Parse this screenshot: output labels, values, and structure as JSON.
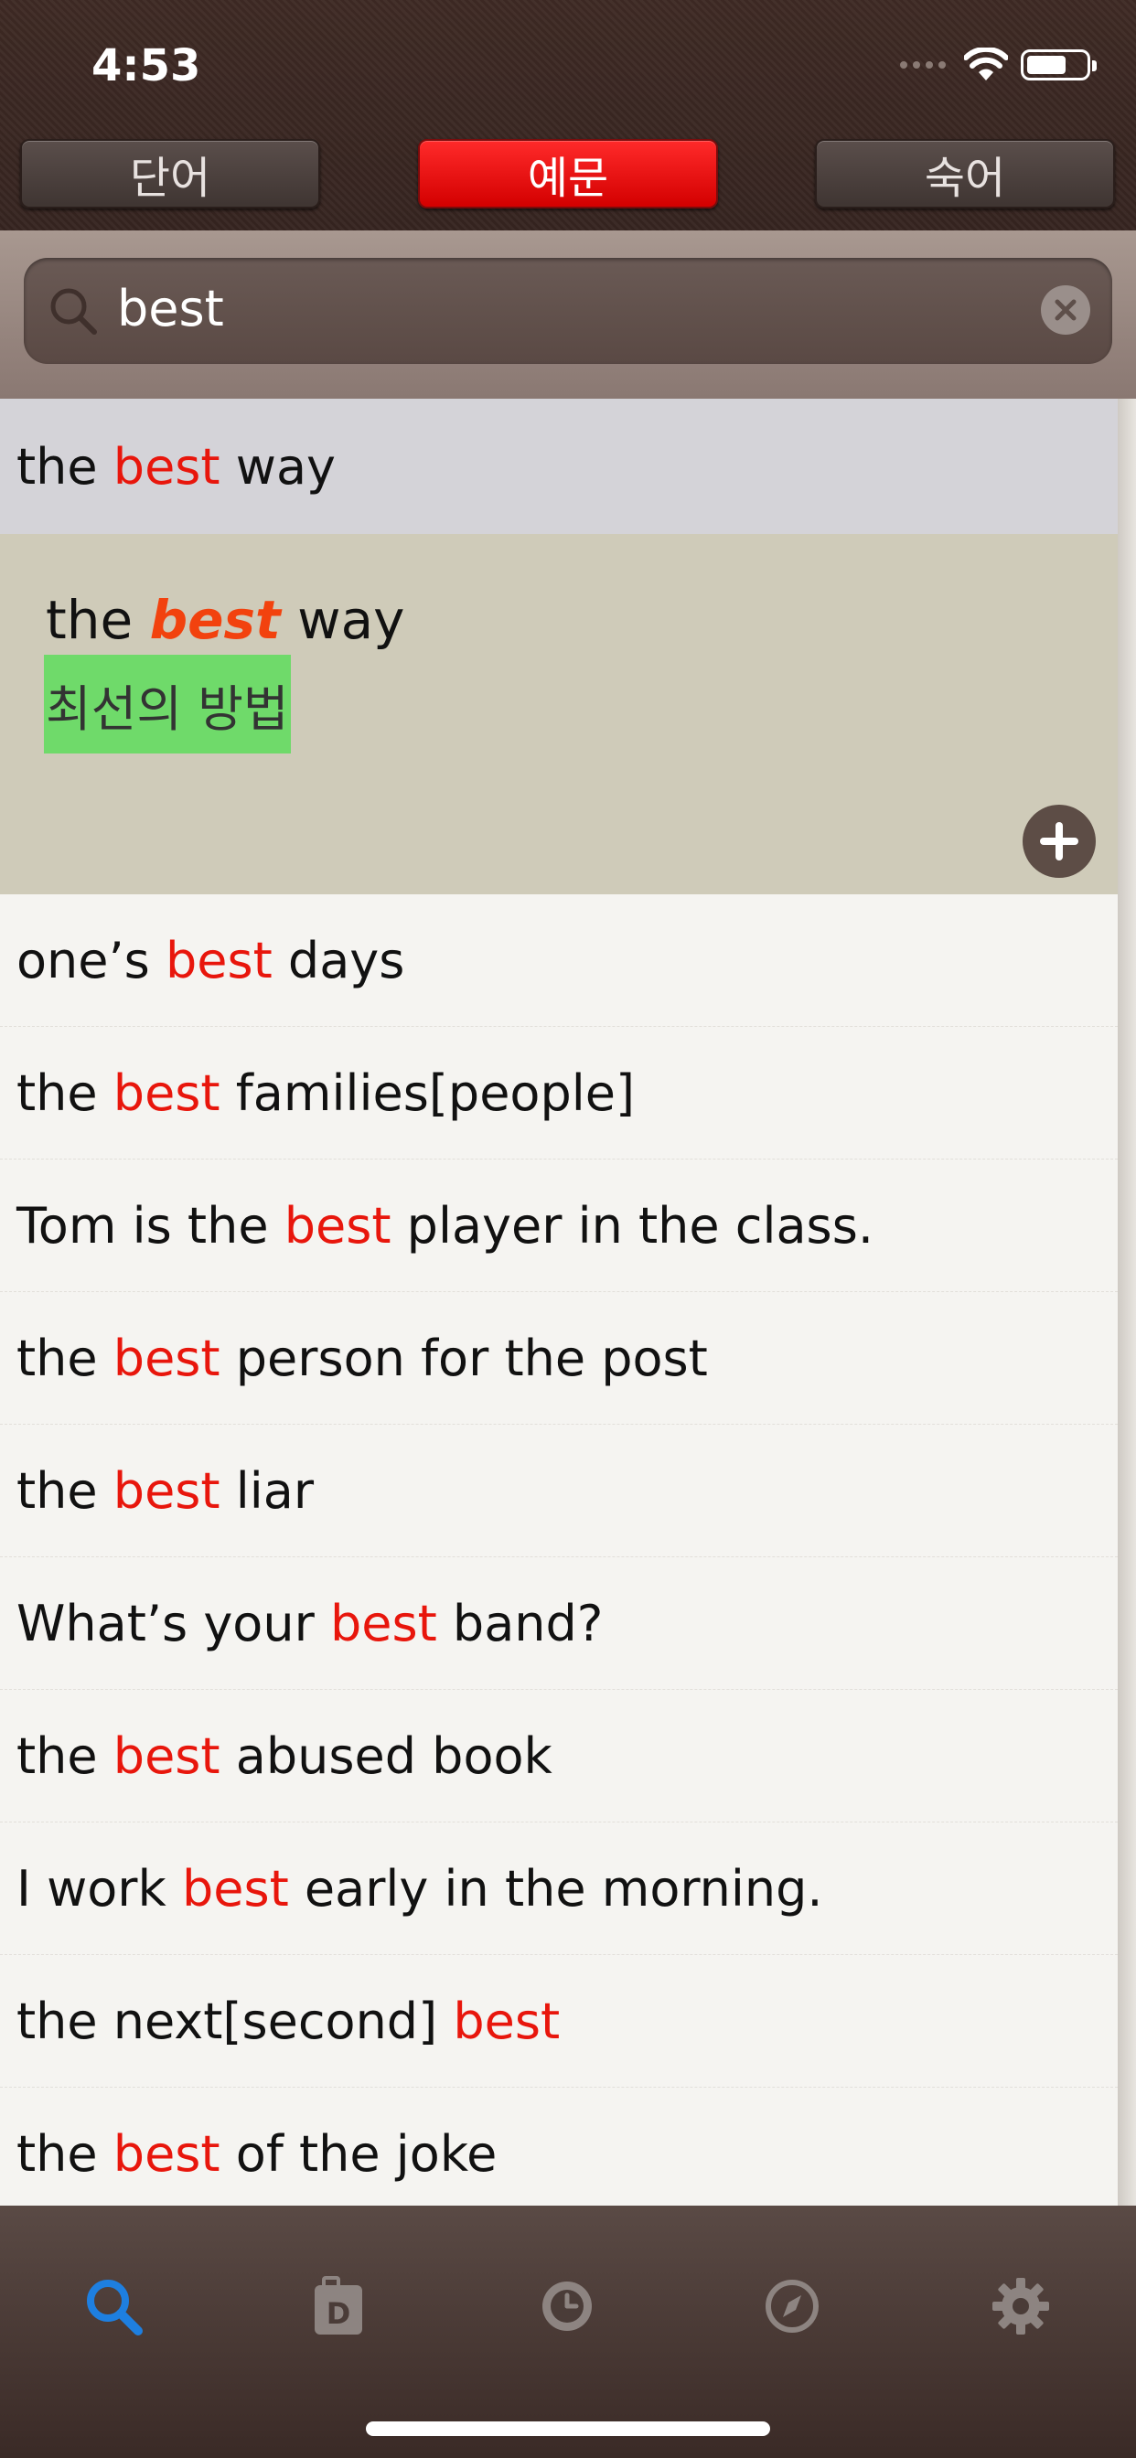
{
  "status": {
    "time": "4:53"
  },
  "segments": [
    {
      "label": "단어",
      "active": false
    },
    {
      "label": "예문",
      "active": true
    },
    {
      "label": "숙어",
      "active": false
    }
  ],
  "search": {
    "value": "best"
  },
  "selected_row": {
    "pre": "the ",
    "hl": "best",
    "post": " way"
  },
  "expanded": {
    "en_pre": "the ",
    "en_hl": "best",
    "en_post": " way",
    "ko": "최선의 방법"
  },
  "rows": [
    {
      "pre": "one’s ",
      "hl": "best",
      "post": " days"
    },
    {
      "pre": "the ",
      "hl": "best",
      "post": " families[people]"
    },
    {
      "pre": "Tom is the ",
      "hl": "best",
      "post": " player in the class."
    },
    {
      "pre": "the ",
      "hl": "best",
      "post": " person for the post"
    },
    {
      "pre": "the ",
      "hl": "best",
      "post": " liar"
    },
    {
      "pre": "What’s your ",
      "hl": "best",
      "post": " band?"
    },
    {
      "pre": "the ",
      "hl": "best",
      "post": " abused book"
    },
    {
      "pre": "I work ",
      "hl": "best",
      "post": " early in the morning."
    },
    {
      "pre": "the next[second] ",
      "hl": "best",
      "post": ""
    },
    {
      "pre": "the ",
      "hl": "best",
      "post": " of the joke"
    }
  ],
  "tabs": [
    {
      "icon": "search-icon",
      "active": true
    },
    {
      "icon": "dictionary-icon",
      "active": false
    },
    {
      "icon": "history-icon",
      "active": false
    },
    {
      "icon": "compass-icon",
      "active": false
    },
    {
      "icon": "settings-gear-icon",
      "active": false
    }
  ],
  "colors": {
    "accent": "#e8160c",
    "highlight_bg": "#6fda6a",
    "tab_active": "#1e7fe0"
  }
}
